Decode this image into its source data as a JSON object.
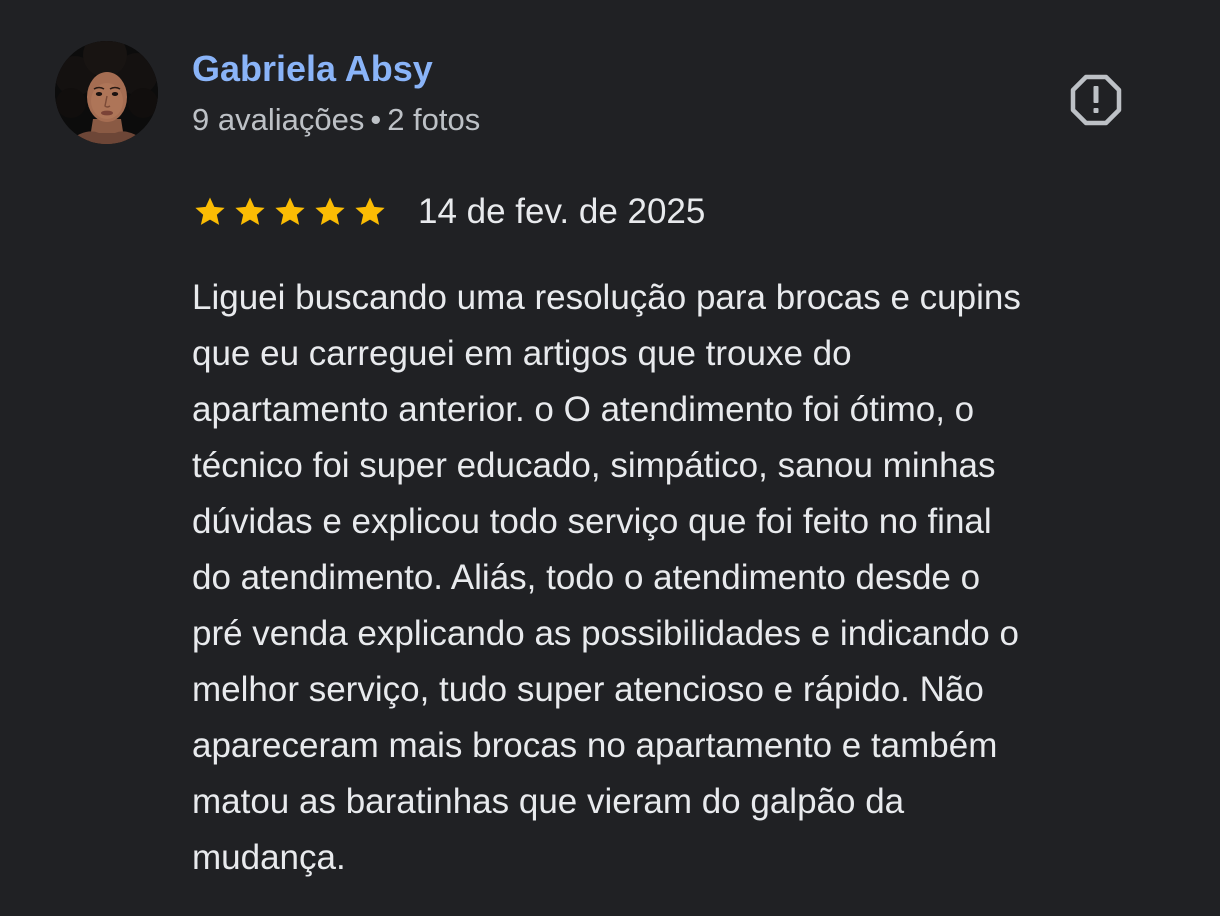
{
  "review": {
    "author": {
      "name": "Gabriela Absy",
      "reviews_count": "9 avaliações",
      "separator": "•",
      "photos_count": "2 fotos",
      "avatar_icon": "user-photo-avatar"
    },
    "rating": {
      "stars": 5,
      "max": 5,
      "star_color": "#fbbc04",
      "date": "14 de fev. de 2025"
    },
    "report_icon": "report-octagon-icon",
    "text_lines": [
      "Liguei buscando uma resolução para brocas e cupins",
      "que eu carreguei em artigos que trouxe do",
      "apartamento anterior. o O atendimento foi ótimo, o",
      "técnico foi super educado, simpático, sanou minhas",
      "dúvidas e explicou todo serviço que foi feito no final",
      "do atendimento. Aliás, todo o atendimento desde o",
      "pré venda explicando as possibilidades e indicando o",
      "melhor serviço, tudo super atencioso e rápido. Não",
      "apareceram mais brocas no apartamento e também",
      "matou as baratinhas que vieram do galpão da",
      "mudança."
    ]
  },
  "colors": {
    "background": "#202124",
    "author_name": "#8ab4f8",
    "secondary_text": "#bdc1c6",
    "primary_text": "#e8eaed",
    "icon": "#bdc1c6"
  }
}
